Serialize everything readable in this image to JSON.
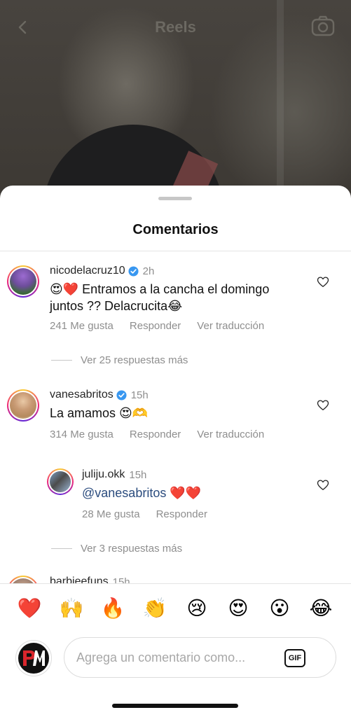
{
  "header": {
    "title": "Reels"
  },
  "sheet": {
    "title": "Comentarios"
  },
  "comments": [
    {
      "username": "nicodelacruz10",
      "verified": true,
      "time": "2h",
      "text": "😍❤️ Entramos a la cancha el domingo juntos ?? Delacrucita😂",
      "likes": "241 Me gusta",
      "reply": "Responder",
      "translate": "Ver traducción",
      "more_replies": "Ver 25 respuestas más"
    },
    {
      "username": "vanesabritos",
      "verified": true,
      "time": "15h",
      "text": "La amamos 😍🫶",
      "likes": "314 Me gusta",
      "reply": "Responder",
      "translate": "Ver traducción"
    },
    {
      "username": "juliju.okk",
      "verified": false,
      "time": "15h",
      "mention": "@vanesabritos",
      "text": "❤️❤️",
      "likes": "28 Me gusta",
      "reply": "Responder",
      "more_replies": "Ver 3 respuestas más"
    },
    {
      "username": "barbieefuns",
      "time": "15h"
    }
  ],
  "emoji_bar": [
    "❤️",
    "🙌",
    "🔥",
    "👏",
    "😢",
    "😍",
    "😮",
    "😂"
  ],
  "composer": {
    "placeholder": "Agrega un comentario como...",
    "gif_label": "GIF"
  }
}
